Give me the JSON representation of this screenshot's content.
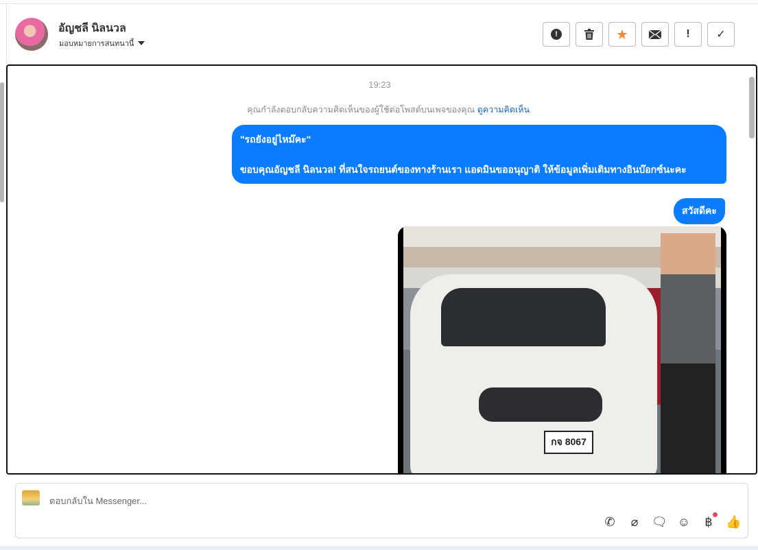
{
  "header": {
    "name": "อัญชลี นิลนวล",
    "assign_label": "มอบหมายการสนทนานี้",
    "actions": [
      {
        "icon": "alert-circle-icon",
        "glyph": "⬤"
      },
      {
        "icon": "trash-icon",
        "glyph": "🗑"
      },
      {
        "icon": "star-icon",
        "glyph": "★"
      },
      {
        "icon": "envelope-icon",
        "glyph": "✉"
      },
      {
        "icon": "exclamation-icon",
        "glyph": "!"
      },
      {
        "icon": "check-icon",
        "glyph": "✓"
      }
    ]
  },
  "chat": {
    "timestamp": "19:23",
    "notice": "คุณกำลังตอบกลับความคิดเห็นของผู้ใช้ต่อโพสต์บนเพจของคุณ",
    "notice_link": "ดูความคิดเห็น",
    "messages": [
      {
        "quote": "\"รถยังอยู่ไหม๊คะ\"",
        "text": "ขอบคุณอัญชลี นิลนวล! ที่สนใจรถยนต์ของทางร้านเรา แอดมินขออนุญาติ ให้ข้อมูลเพิ่มเติมทางอินบ๊อกซ์นะคะ"
      },
      {
        "text": "สวัสดีคะ"
      }
    ],
    "video_plate": "กจ 8067"
  },
  "composer": {
    "placeholder": "ตอบกลับใน Messenger...",
    "tools": [
      {
        "icon": "phone-add-icon",
        "glyph": "✆"
      },
      {
        "icon": "paperclip-icon",
        "glyph": "📎"
      },
      {
        "icon": "chat-bubble-icon",
        "glyph": "💬"
      },
      {
        "icon": "emoji-icon",
        "glyph": "☺"
      },
      {
        "icon": "baht-icon",
        "glyph": "฿"
      },
      {
        "icon": "thumbs-up-icon",
        "glyph": "👍"
      }
    ]
  },
  "colors": {
    "bubble": "#0a7cff",
    "star": "#f7882f",
    "badge": "#e8455f"
  }
}
